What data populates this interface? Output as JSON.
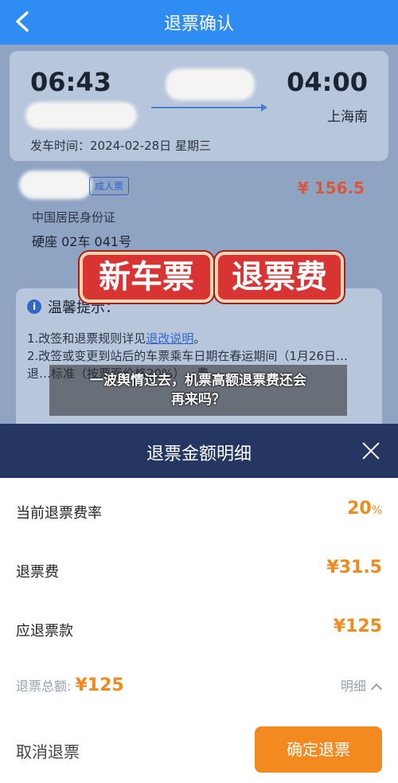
{
  "header": {
    "title": "退票确认",
    "back_icon": "chevron-left-icon"
  },
  "ticket": {
    "departure_time": "06:43",
    "arrival_time": "04:00",
    "arrival_station": "上海南",
    "departure_date": "发车时间：2024-02-28日 星期三"
  },
  "passenger": {
    "ticket_type": "成人票",
    "price": "¥ 156.5",
    "id_type": "中国居民身份证",
    "seat": "硬座 02车 041号"
  },
  "notice": {
    "title": "温馨提示：",
    "line1_prefix": "1.改签和退票规则详见",
    "line1_link": "退改说明",
    "line1_suffix": "。",
    "line2": "2.改签或变更到站后的车票乘车日期在春运期间（1月26日…退…标准（按票面价格20%）…费。"
  },
  "stamps": {
    "left": "新车票",
    "right": "退票费"
  },
  "caption": {
    "line1": "一波舆情过去，机票高额退票费还会",
    "line2": "再来吗？"
  },
  "sheet": {
    "title": "退票金额明细",
    "rows": [
      {
        "label": "当前退票费率",
        "value": "20",
        "unit": "%"
      },
      {
        "label": "退票费",
        "value": "¥31.5"
      },
      {
        "label": "应退票款",
        "value": "¥125"
      }
    ],
    "total_label": "退票总额:",
    "total_value": "¥125",
    "detail_label": "明细",
    "cancel_label": "取消退票",
    "confirm_label": "确定退票"
  },
  "colors": {
    "primary": "#2f8cf2",
    "accent": "#f38a1f",
    "sheet_header": "#253662"
  }
}
